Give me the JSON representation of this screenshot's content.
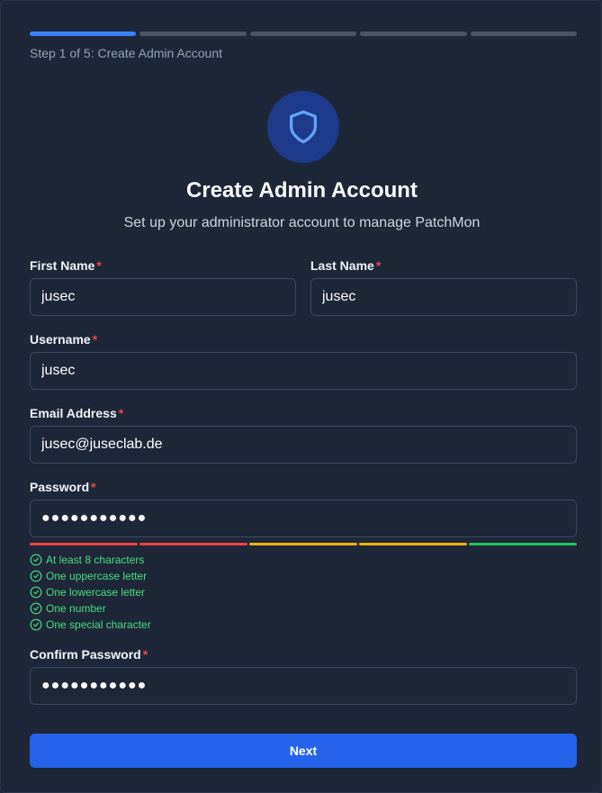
{
  "progress": {
    "steps": [
      {
        "active": true
      },
      {
        "active": false
      },
      {
        "active": false
      },
      {
        "active": false
      },
      {
        "active": false
      }
    ]
  },
  "step_text": "Step 1 of 5: Create Admin Account",
  "icon": "shield-icon",
  "title": "Create Admin Account",
  "subtitle": "Set up your administrator account to manage PatchMon",
  "required_marker": "*",
  "fields": {
    "first_name": {
      "label": "First Name",
      "value": "jusec"
    },
    "last_name": {
      "label": "Last Name",
      "value": "jusec"
    },
    "username": {
      "label": "Username",
      "value": "jusec"
    },
    "email": {
      "label": "Email Address",
      "value": "jusec@juseclab.de"
    },
    "password": {
      "label": "Password",
      "value": "●●●●●●●●●●●"
    },
    "confirm_password": {
      "label": "Confirm Password",
      "value": "●●●●●●●●●●●"
    }
  },
  "strength_colors": [
    "#ef4444",
    "#ef4444",
    "#eab308",
    "#eab308",
    "#22c55e"
  ],
  "requirements": [
    "At least 8 characters",
    "One uppercase letter",
    "One lowercase letter",
    "One number",
    "One special character"
  ],
  "next_label": "Next",
  "colors": {
    "accent": "#3b82f6",
    "button": "#2563eb",
    "success": "#4ade80",
    "required": "#ef4444"
  }
}
